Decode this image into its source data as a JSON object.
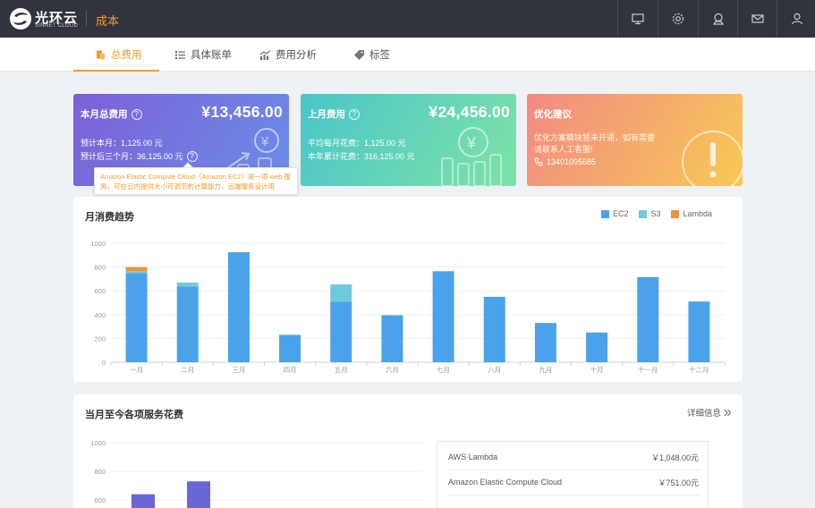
{
  "app": {
    "logo_text": "光环云",
    "logo_sub": "SINNET CLOUD",
    "section_title": "成本"
  },
  "top_icons": [
    "monitor-icon",
    "gear-icon",
    "support-icon",
    "mail-icon",
    "user-icon"
  ],
  "tabs": [
    {
      "label": "总费用",
      "icon": "coins-icon",
      "active": true
    },
    {
      "label": "具体账单",
      "icon": "list-icon",
      "active": false
    },
    {
      "label": "费用分析",
      "icon": "trend-icon",
      "active": false
    },
    {
      "label": "标签",
      "icon": "tag-icon",
      "active": false
    }
  ],
  "cards": {
    "month": {
      "title": "本月总费用",
      "amount": "¥13,456.00",
      "line1": "预计本月：1,125.00 元",
      "line2": "预计后三个月：36,125.00 元"
    },
    "last_month": {
      "title": "上月费用",
      "amount": "¥24,456.00",
      "line1": "平均每月花费：1,125.00 元",
      "line2": "本年累计花费：316,125.00 元"
    },
    "advice": {
      "title": "优化建议",
      "line1": "优化方案模块暂未开通，如有需要",
      "line2": "请联系人工客服!",
      "phone": "13401095685"
    }
  },
  "tooltip": {
    "text": "Amazon Elastic Compute Cloud（Amazon EC2）是一项 web 服务，可在云内提供大小可调节的计算能力，远端服务设计用"
  },
  "colors": {
    "accent": "#f29a2e",
    "ec2": "#4aa3ea",
    "s3": "#6fcbdc",
    "lambda": "#e8963a",
    "bar2": "#6a66d8"
  },
  "chart_data": [
    {
      "type": "bar",
      "title": "月消费趋势",
      "categories": [
        "一月",
        "二月",
        "三月",
        "四月",
        "五月",
        "六月",
        "七月",
        "八月",
        "九月",
        "十月",
        "十一月",
        "十二月"
      ],
      "series": [
        {
          "name": "EC2",
          "values": [
            750,
            635,
            925,
            230,
            510,
            395,
            765,
            550,
            330,
            250,
            715,
            510
          ]
        },
        {
          "name": "S3",
          "values": [
            15,
            35,
            0,
            0,
            145,
            0,
            0,
            0,
            0,
            0,
            0,
            0
          ]
        },
        {
          "name": "Lambda",
          "values": [
            35,
            0,
            0,
            0,
            0,
            0,
            0,
            0,
            0,
            0,
            0,
            0
          ]
        }
      ],
      "stacked": true,
      "yticks": [
        "0",
        "200",
        "400",
        "600",
        "800",
        "1000"
      ],
      "ylim": [
        0,
        1000
      ],
      "legend": "top-right",
      "grid": true
    },
    {
      "type": "bar",
      "title": "当月至今各项服务花费",
      "categories": [
        "",
        ""
      ],
      "values": [
        640,
        730
      ],
      "yticks": [
        "600",
        "800",
        "1000"
      ],
      "ylim": [
        0,
        1000
      ],
      "grid": true
    }
  ],
  "services_panel": {
    "title": "当月至今各项服务花费",
    "detail_label": "详细信息",
    "rows": [
      {
        "name": "AWS Lambda",
        "amount": "￥1,048.00元"
      },
      {
        "name": "Amazon Elastic Compute Cloud",
        "amount": "￥751.00元"
      }
    ]
  }
}
